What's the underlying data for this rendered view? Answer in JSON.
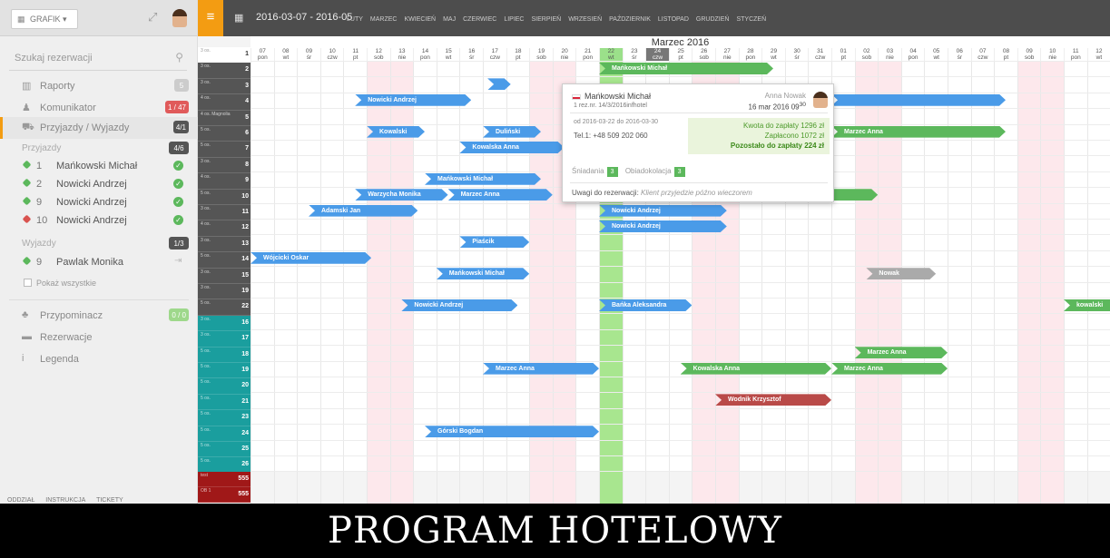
{
  "sidebar": {
    "grafik_label": "GRAFIK",
    "search_placeholder": "Szukaj rezerwacji",
    "menu": [
      {
        "icon": "chart-icon",
        "label": "Raporty",
        "badge": "5",
        "badge_color": "#cccccc"
      },
      {
        "icon": "users-icon",
        "label": "Komunikator",
        "badge": "1 / 47",
        "badge_color": "#e05a5a"
      },
      {
        "icon": "car-icon",
        "label": "Przyjazdy / Wyjazdy",
        "badge": "4/1",
        "badge_color": "#555555"
      }
    ],
    "arrivals": {
      "title": "Przyjazdy",
      "badge": "4/6",
      "items": [
        {
          "nr": "1",
          "name": "Mańkowski Michał",
          "color": "#5cb85c"
        },
        {
          "nr": "2",
          "name": "Nowicki Andrzej",
          "color": "#5cb85c"
        },
        {
          "nr": "9",
          "name": "Nowicki Andrzej",
          "color": "#5cb85c"
        },
        {
          "nr": "10",
          "name": "Nowicki Andrzej",
          "color": "#d9534f"
        }
      ]
    },
    "departures": {
      "title": "Wyjazdy",
      "badge": "1/3",
      "items": [
        {
          "nr": "9",
          "name": "Pawlak Monika",
          "color": "#5cb85c"
        }
      ]
    },
    "show_all": "Pokaż wszystkie",
    "lower_menu": [
      {
        "icon": "bell-icon",
        "label": "Przypominacz",
        "badge": "0 / 0",
        "badge_color": "#9ed88b"
      },
      {
        "icon": "bed-icon",
        "label": "Rezerwacje"
      },
      {
        "icon": "info-icon",
        "label": "Legenda"
      }
    ],
    "bottom_tabs": [
      "ODDZIAŁ",
      "INSTRUKCJA",
      "TICKETY"
    ]
  },
  "toolbar": {
    "date_range": "2016-03-07 - 2016-05",
    "months": [
      "LUTY",
      "MARZEC",
      "KWIECIEŃ",
      "MAJ",
      "CZERWIEC",
      "LIPIEC",
      "SIERPIEŃ",
      "WRZESIEŃ",
      "PAŹDZIERNIK",
      "LISTOPAD",
      "GRUDZIEŃ",
      "STYCZEŃ"
    ]
  },
  "calendar": {
    "month_title": "Marzec 2016",
    "days": [
      [
        "07",
        "pon"
      ],
      [
        "08",
        "wt"
      ],
      [
        "09",
        "śr"
      ],
      [
        "10",
        "czw"
      ],
      [
        "11",
        "pt"
      ],
      [
        "12",
        "sob"
      ],
      [
        "13",
        "nie"
      ],
      [
        "14",
        "pon"
      ],
      [
        "15",
        "wt"
      ],
      [
        "16",
        "śr"
      ],
      [
        "17",
        "czw"
      ],
      [
        "18",
        "pt"
      ],
      [
        "19",
        "sob"
      ],
      [
        "20",
        "nie"
      ],
      [
        "21",
        "pon"
      ],
      [
        "22",
        "wt"
      ],
      [
        "23",
        "śr"
      ],
      [
        "24",
        "czw"
      ],
      [
        "25",
        "pt"
      ],
      [
        "26",
        "sob"
      ],
      [
        "27",
        "nie"
      ],
      [
        "28",
        "pon"
      ],
      [
        "29",
        "wt"
      ],
      [
        "30",
        "śr"
      ],
      [
        "31",
        "czw"
      ],
      [
        "01",
        "pt"
      ],
      [
        "02",
        "sob"
      ],
      [
        "03",
        "nie"
      ],
      [
        "04",
        "pon"
      ],
      [
        "05",
        "wt"
      ],
      [
        "06",
        "śr"
      ],
      [
        "07",
        "czw"
      ],
      [
        "08",
        "pt"
      ],
      [
        "09",
        "sob"
      ],
      [
        "10",
        "nie"
      ],
      [
        "11",
        "pon"
      ],
      [
        "12",
        "wt"
      ]
    ],
    "today_index": 15,
    "selected_index": 17,
    "rooms": [
      {
        "size": "3 os.",
        "nr": "1",
        "color": "#ffffff"
      },
      {
        "size": "3 os.",
        "nr": "2",
        "color": "#555555"
      },
      {
        "size": "3 os.",
        "nr": "3",
        "color": "#555555"
      },
      {
        "size": "4 os.",
        "nr": "4",
        "color": "#555555"
      },
      {
        "size": "4 os. Magnolia",
        "nr": "5",
        "color": "#555555"
      },
      {
        "size": "5 os.",
        "nr": "6",
        "color": "#555555"
      },
      {
        "size": "5 os.",
        "nr": "7",
        "color": "#555555"
      },
      {
        "size": "3 os.",
        "nr": "8",
        "color": "#555555"
      },
      {
        "size": "4 os.",
        "nr": "9",
        "color": "#555555"
      },
      {
        "size": "5 os.",
        "nr": "10",
        "color": "#555555"
      },
      {
        "size": "3 os.",
        "nr": "11",
        "color": "#555555"
      },
      {
        "size": "4 os.",
        "nr": "12",
        "color": "#555555"
      },
      {
        "size": "3 os.",
        "nr": "13",
        "color": "#555555"
      },
      {
        "size": "5 os.",
        "nr": "14",
        "color": "#555555"
      },
      {
        "size": "3 os.",
        "nr": "15",
        "color": "#555555"
      },
      {
        "size": "3 os.",
        "nr": "19",
        "color": "#555555"
      },
      {
        "size": "5 os.",
        "nr": "22",
        "color": "#555555"
      },
      {
        "size": "3 os.",
        "nr": "16",
        "color": "#1a9e9e"
      },
      {
        "size": "3 os.",
        "nr": "17",
        "color": "#1a9e9e"
      },
      {
        "size": "5 os.",
        "nr": "18",
        "color": "#1a9e9e"
      },
      {
        "size": "5 os.",
        "nr": "19",
        "color": "#1a9e9e"
      },
      {
        "size": "5 os.",
        "nr": "20",
        "color": "#1a9e9e"
      },
      {
        "size": "5 os.",
        "nr": "21",
        "color": "#1a9e9e"
      },
      {
        "size": "5 os.",
        "nr": "23",
        "color": "#1a9e9e"
      },
      {
        "size": "5 os.",
        "nr": "24",
        "color": "#1a9e9e"
      },
      {
        "size": "5 os.",
        "nr": "25",
        "color": "#1a9e9e"
      },
      {
        "size": "5 os.",
        "nr": "26",
        "color": "#1a9e9e"
      }
    ],
    "extra_rooms": [
      {
        "size": "test",
        "nr": "555",
        "color": "#a01818"
      },
      {
        "size": "OB 1",
        "nr": "555",
        "color": "#a01818"
      }
    ],
    "reservations": [
      {
        "row": 0,
        "start": 15,
        "end": 22.5,
        "name": "Mańkowski Michał",
        "color": "#5cb85c"
      },
      {
        "row": 1,
        "start": 10.2,
        "end": 11.2,
        "name": "",
        "color": "#4a9be8"
      },
      {
        "row": 2,
        "start": 4.5,
        "end": 9.5,
        "name": "Nowicki Andrzej",
        "color": "#4a9be8"
      },
      {
        "row": 2,
        "start": 25,
        "end": 32.5,
        "name": "",
        "color": "#4a9be8"
      },
      {
        "row": 4,
        "start": 5,
        "end": 7.5,
        "name": "Kowalski",
        "color": "#4a9be8"
      },
      {
        "row": 4,
        "start": 10,
        "end": 12.5,
        "name": "Duliński",
        "color": "#4a9be8"
      },
      {
        "row": 4,
        "start": 25,
        "end": 32.5,
        "name": "Marzec Anna",
        "color": "#5cb85c"
      },
      {
        "row": 5,
        "start": 9,
        "end": 13.5,
        "name": "Kowalska Anna",
        "color": "#4a9be8"
      },
      {
        "row": 7,
        "start": 7.5,
        "end": 12.5,
        "name": "Mańkowski Michał",
        "color": "#4a9be8"
      },
      {
        "row": 8,
        "start": 4.5,
        "end": 8.5,
        "name": "Warzycha Monika",
        "color": "#4a9be8"
      },
      {
        "row": 8,
        "start": 8.5,
        "end": 13,
        "name": "Marzec Anna",
        "color": "#4a9be8"
      },
      {
        "row": 8,
        "start": 24.5,
        "end": 27,
        "name": "",
        "color": "#5cb85c"
      },
      {
        "row": 9,
        "start": 2.5,
        "end": 7.2,
        "name": "Adamski Jan",
        "color": "#4a9be8"
      },
      {
        "row": 9,
        "start": 15,
        "end": 20.5,
        "name": "Nowicki Andrzej",
        "color": "#4a9be8"
      },
      {
        "row": 10,
        "start": 15,
        "end": 20.5,
        "name": "Nowicki Andrzej",
        "color": "#4a9be8"
      },
      {
        "row": 11,
        "start": 9,
        "end": 12,
        "name": "Piaścik",
        "color": "#4a9be8"
      },
      {
        "row": 12,
        "start": 0,
        "end": 5.2,
        "name": "Wójcicki Oskar",
        "color": "#4a9be8"
      },
      {
        "row": 13,
        "start": 8,
        "end": 12,
        "name": "Mańkowski Michał",
        "color": "#4a9be8"
      },
      {
        "row": 13,
        "start": 26.5,
        "end": 29.5,
        "name": "Nowak",
        "color": "#aaaaaa"
      },
      {
        "row": 15,
        "start": 6.5,
        "end": 11.5,
        "name": "Nowicki Andrzej",
        "color": "#4a9be8"
      },
      {
        "row": 15,
        "start": 15,
        "end": 19,
        "name": "Bańka Aleksandra",
        "color": "#4a9be8"
      },
      {
        "row": 15,
        "start": 35,
        "end": 37.5,
        "name": "kowalski",
        "color": "#5cb85c"
      },
      {
        "row": 18,
        "start": 26,
        "end": 30,
        "name": "Marzec Anna",
        "color": "#5cb85c"
      },
      {
        "row": 19,
        "start": 10,
        "end": 15,
        "name": "Marzec Anna",
        "color": "#4a9be8"
      },
      {
        "row": 19,
        "start": 18.5,
        "end": 25,
        "name": "Kowalska Anna",
        "color": "#5cb85c"
      },
      {
        "row": 19,
        "start": 25,
        "end": 30,
        "name": "Marzec Anna",
        "color": "#5cb85c"
      },
      {
        "row": 21,
        "start": 20,
        "end": 25,
        "name": "Wodnik Krzysztof",
        "color": "#b94a48"
      },
      {
        "row": 23,
        "start": 7.5,
        "end": 15,
        "name": "Górski Bogdan",
        "color": "#4a9be8"
      }
    ]
  },
  "popup": {
    "guest": "Mańkowski Michał",
    "rez_nr": "1  rez.nr. 14/3/2016infhotel",
    "operator": "Anna Nowak",
    "date": "16 mar 2016 09",
    "date_sup": "30",
    "range": "od 2016-03-22 do 2016-03-30",
    "phone": "Tel.1: +48 509 202 060",
    "to_pay": "Kwota do zapłaty  1296 zł",
    "paid": "Zapłacono  1072 zł",
    "remaining": "Pozostało do zapłaty  224 zł",
    "breakfast": "Śniadania",
    "breakfast_count": "3",
    "dinner": "Obiadokolacja",
    "dinner_count": "3",
    "notes_label": "Uwagi do rezerwacji:",
    "notes": "Klient przyjedzie późno wieczorem"
  },
  "banner": "PROGRAM HOTELOWY"
}
